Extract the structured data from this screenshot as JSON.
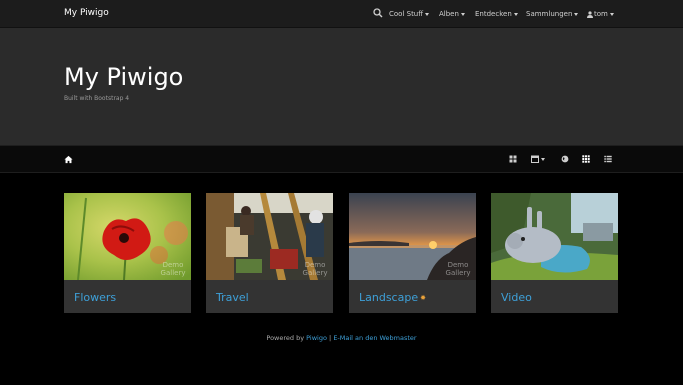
{
  "navbar": {
    "brand": "My Piwigo",
    "items": [
      {
        "label": "Cool Stuff"
      },
      {
        "label": "Alben"
      },
      {
        "label": "Entdecken"
      },
      {
        "label": "Sammlungen"
      },
      {
        "label": "tom"
      }
    ]
  },
  "jumbotron": {
    "title": "My Piwigo",
    "subtitle": "Built with Bootstrap 4"
  },
  "albums": [
    {
      "title": "Flowers",
      "watermark": "Demo Gallery"
    },
    {
      "title": "Travel",
      "watermark": "Demo Gallery"
    },
    {
      "title": "Landscape",
      "watermark": "Demo Gallery"
    },
    {
      "title": "Video",
      "watermark": ""
    }
  ],
  "footer": {
    "prefix": "Powered by",
    "piwigo_link": "Piwigo",
    "separator": "|",
    "webmaster_link": "E-Mail an den Webmaster"
  },
  "colors": {
    "accent": "#3ea0d8",
    "navbar_bg": "#1c1c1c",
    "jumbotron_bg": "#2b2b2b",
    "card_bg": "#333333"
  },
  "icons": [
    "search-icon",
    "user-icon",
    "home-icon",
    "grid-icon",
    "calendar-icon",
    "globe-icon",
    "grid-small-icon",
    "list-icon",
    "new-badge-icon"
  ]
}
